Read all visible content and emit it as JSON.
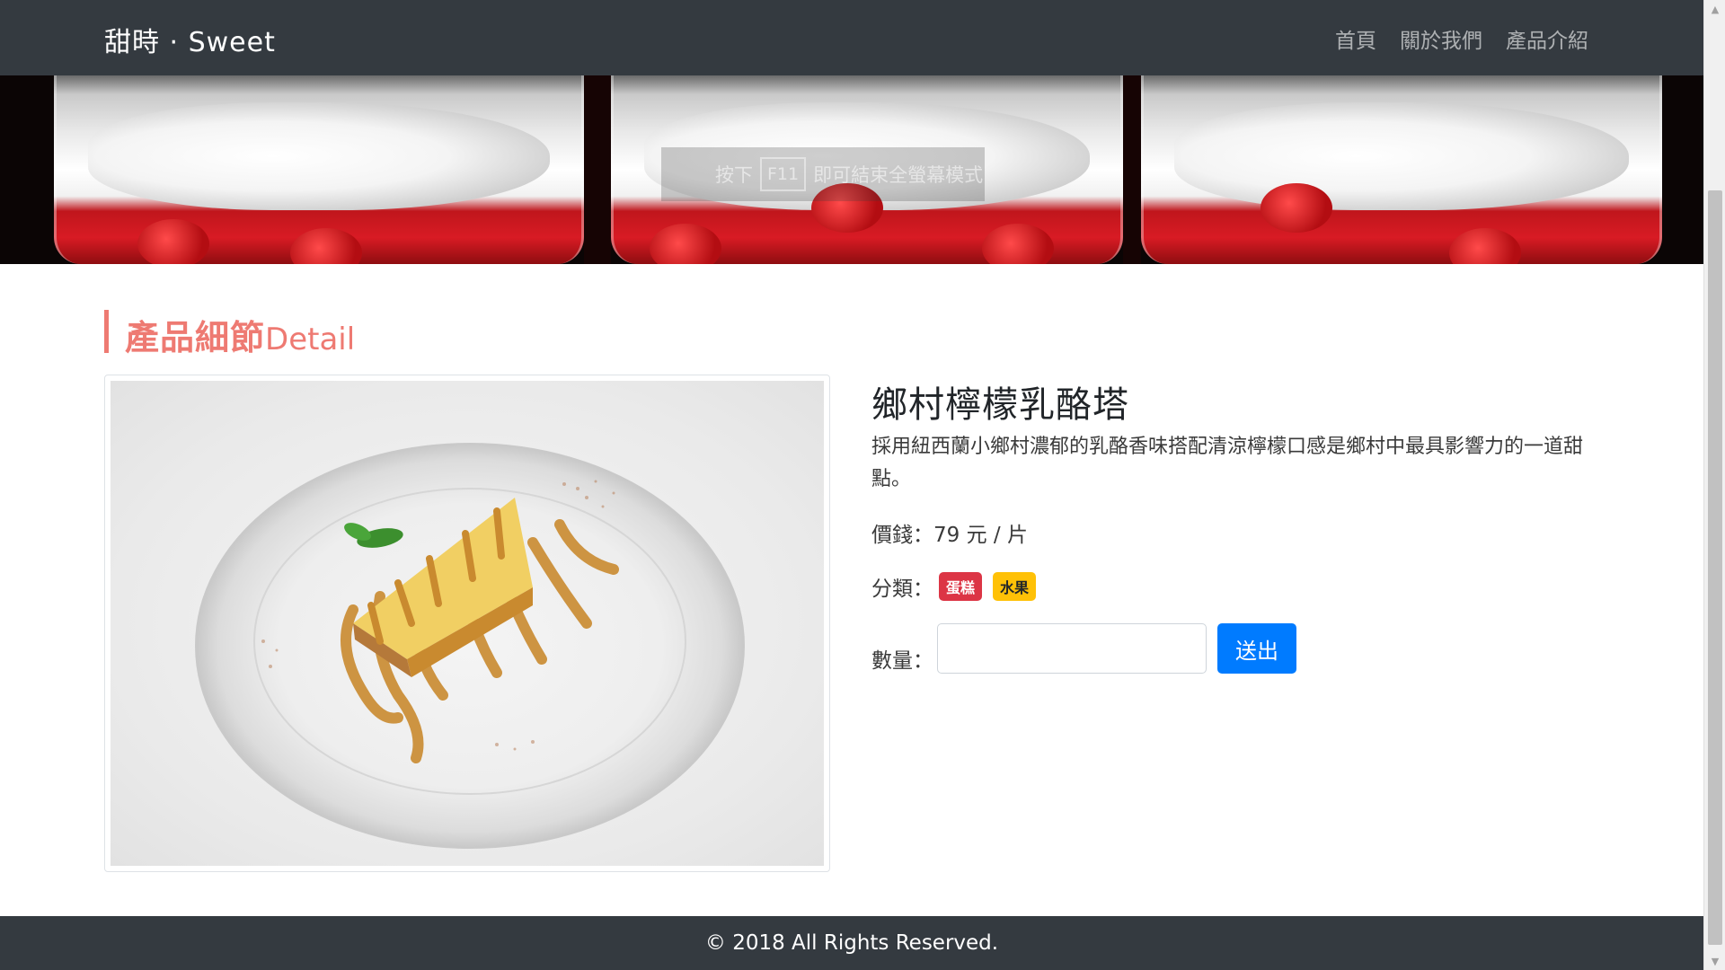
{
  "navbar": {
    "brand": "甜時 · Sweet",
    "links": [
      "首頁",
      "關於我們",
      "產品介紹"
    ]
  },
  "overlay": {
    "hint_prefix": "按下",
    "hint_key": "F11",
    "hint_suffix": "即可結束全螢幕模式"
  },
  "section": {
    "title_zh": "產品細節",
    "title_en": "Detail"
  },
  "product": {
    "name": "鄉村檸檬乳酪塔",
    "description": "採用紐西蘭小鄉村濃郁的乳酪香味搭配清涼檸檬口感是鄉村中最具影響力的一道甜點。",
    "price_label": "價錢：",
    "price_value": "79 元 / 片",
    "category_label": "分類：",
    "categories": [
      "蛋糕",
      "水果"
    ],
    "quantity_label": "數量：",
    "quantity_value": "",
    "submit_label": "送出"
  },
  "footer": {
    "copyright": "© 2018 All Rights Reserved."
  },
  "colors": {
    "navbar_bg": "#343a40",
    "accent": "#ee7a72",
    "primary_button": "#007bff",
    "badge_danger": "#dc3545",
    "badge_warning": "#ffc107"
  }
}
